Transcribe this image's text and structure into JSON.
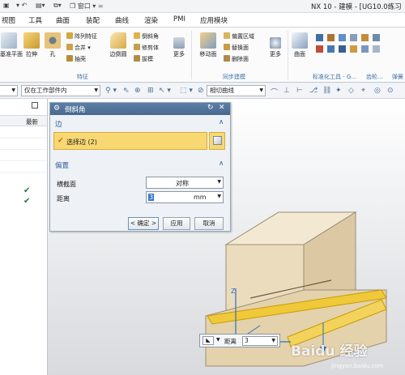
{
  "window": {
    "title": "NX 10 - 建模 - [UG10.0练习"
  },
  "quick_access": {
    "window_menu": "窗口"
  },
  "menubar": {
    "items": [
      "视图",
      "工具",
      "曲面",
      "装配",
      "曲线",
      "渲染",
      "PMI",
      "应用模块"
    ]
  },
  "ribbon": {
    "feature_buttons": [
      "基准平面",
      "拉伸",
      "孔"
    ],
    "feature_small": [
      "阵列特征",
      "合并",
      "抽壳"
    ],
    "edge_blend": "边倒圆",
    "feature_small2": [
      "倒斜角",
      "修剪体",
      "拔模"
    ],
    "more": "更多",
    "feature_group": "特征",
    "sync_move": "移动面",
    "sync_small": [
      "偏置区域",
      "替换面",
      "删除面"
    ],
    "sync_group": "同步建模",
    "surface": "曲面",
    "std_group": "标准化工具 - G...",
    "gear_group": "齿轮...",
    "spring_group": "弹簧"
  },
  "toolbar2": {
    "filter_value": "仅在工作部件内",
    "curve_rule": "相切曲线"
  },
  "navigator": {
    "column_header": "最新"
  },
  "dialog": {
    "title": "倒斜角",
    "edge_section": "边",
    "select_edge": "选择边 (2)",
    "offset_section": "偏置",
    "cross_section_label": "横截面",
    "cross_section_value": "对称",
    "distance_label": "距离",
    "distance_value": "3",
    "unit": "mm",
    "ok": "< 确定 >",
    "apply": "应用",
    "cancel": "取消"
  },
  "onscreen_input": {
    "label": "距离",
    "value": "3"
  },
  "watermark": {
    "text": "Baidu 经验",
    "sub": "jingyan.baidu.com"
  },
  "colors": {
    "accent": "#3d6fa6",
    "highlight": "#f8d873",
    "dialog_head": "#4f6f97",
    "model": "#ecdcbe",
    "edge": "#e4b400"
  }
}
